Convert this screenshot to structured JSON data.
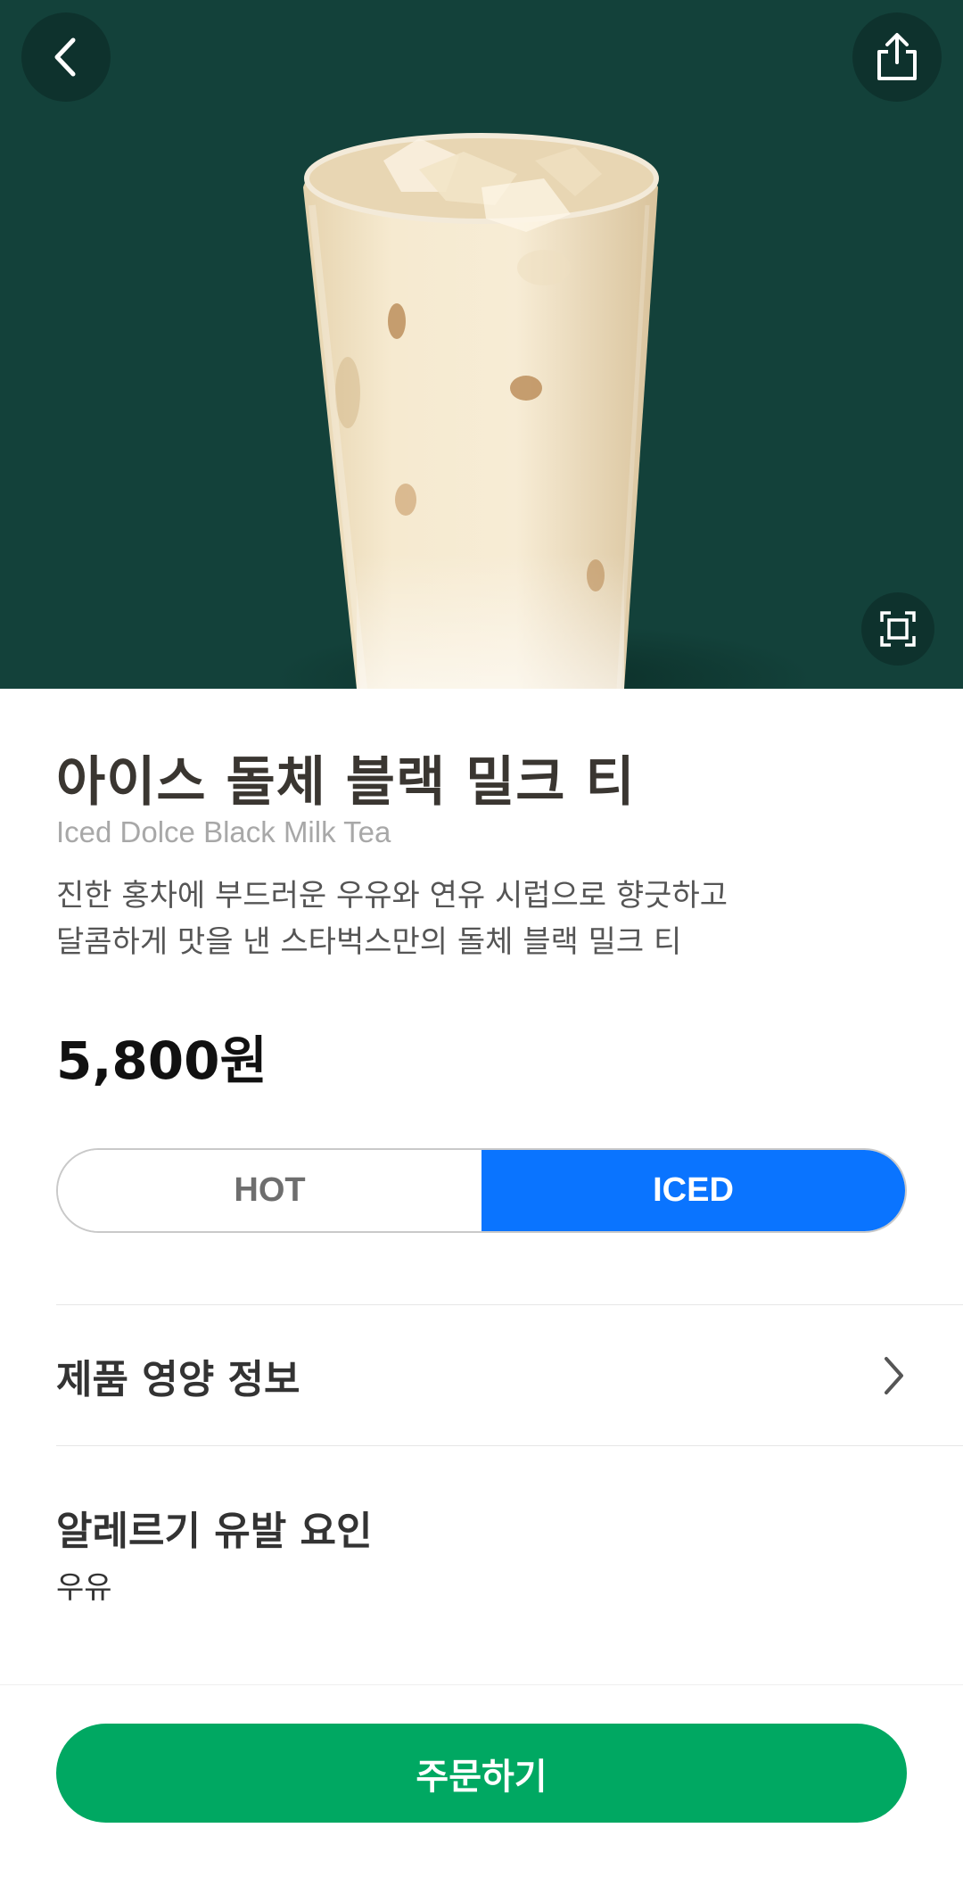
{
  "product": {
    "name_ko": "아이스 돌체 블랙 밀크 티",
    "name_en": "Iced Dolce Black Milk Tea",
    "description_line1": "진한 홍차에 부드러운 우유와 연유 시럽으로 향긋하고",
    "description_line2": "달콤하게 맛을 낸 스타벅스만의 돌체 블랙 밀크 티",
    "price": "5,800원"
  },
  "temperature": {
    "options": [
      "HOT",
      "ICED"
    ],
    "selected": "ICED"
  },
  "nutrition": {
    "label": "제품 영양 정보"
  },
  "allergy": {
    "title": "알레르기 유발 요인",
    "value": "우유"
  },
  "order": {
    "label": "주문하기"
  },
  "icons": {
    "back": "chevron-left-icon",
    "share": "share-icon",
    "zoom": "expand-icon",
    "nutrition_arrow": "chevron-right-icon"
  },
  "colors": {
    "hero_background": "#13413a",
    "selected_toggle": "#0a74ff",
    "order_button": "#00a862"
  }
}
